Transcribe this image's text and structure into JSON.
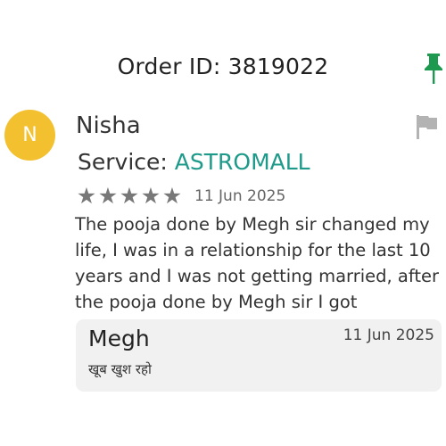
{
  "header": {
    "order_label": "Order ID: 3819022",
    "pin_icon": "pushpin-icon",
    "pin_color": "#1e9a50"
  },
  "review": {
    "avatar_initial": "N",
    "avatar_color": "#f3c02f",
    "user_name": "Nisha",
    "flag_icon": "report-flag-icon",
    "service_label": "Service:",
    "service_value": "ASTROMALL",
    "service_color": "#1e9a8a",
    "rating": 5,
    "rating_max": 5,
    "date": "11 Jun 2025",
    "text": "The pooja done by Megh sir changed my life, I was in a relationship for the last 10 years and I was not getting married, after the pooja done by Megh sir I got"
  },
  "reply": {
    "author": "Megh",
    "date": "11 Jun 2025",
    "text": "खूब खुश रहो"
  }
}
